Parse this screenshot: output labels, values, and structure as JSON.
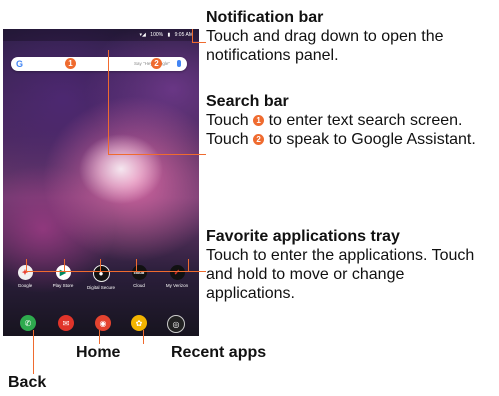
{
  "status_bar": {
    "signal": "▾◢",
    "battery": "100%",
    "time": "9:05 AM"
  },
  "search_bar": {
    "logo": "G",
    "hint": "Say \"Hey Google\"",
    "marker_1": "1",
    "marker_2": "2"
  },
  "favorites": [
    {
      "label": "Google",
      "glyph": "✦",
      "color": "#f1f1f1"
    },
    {
      "label": "Play Store",
      "glyph": "▶",
      "color": "#ffffff"
    },
    {
      "label": "Digital Secure",
      "glyph": "●",
      "color": "#111111"
    },
    {
      "label": "Cloud",
      "glyph": "cloud",
      "color": "#111111"
    },
    {
      "label": "My Verizon",
      "glyph": "✓",
      "color": "#111111"
    }
  ],
  "tray": [
    {
      "name": "phone",
      "glyph": "✆",
      "color": "#2eaa4e"
    },
    {
      "name": "messages",
      "glyph": "✉",
      "color": "#e0342a"
    },
    {
      "name": "chrome",
      "glyph": "◉",
      "color": "#e4432f"
    },
    {
      "name": "photos",
      "glyph": "✿",
      "color": "#f3b400"
    },
    {
      "name": "camera",
      "glyph": "◎",
      "color": "#222222"
    }
  ],
  "callouts": {
    "notification": {
      "title": "Notification bar",
      "desc": "Touch and drag down to open the notifications panel."
    },
    "search": {
      "title": "Search bar",
      "line1_before": "Touch ",
      "marker_1": "1",
      "line1_after": " to enter text search screen.",
      "line2_before": "Touch ",
      "marker_2": "2",
      "line2_after": " to speak to Google Assistant."
    },
    "favorites": {
      "title": "Favorite applications tray",
      "desc": "Touch to enter the applications. Touch and hold to move or change applications."
    }
  },
  "nav_labels": {
    "home": "Home",
    "recent": "Recent apps",
    "back": "Back"
  },
  "colors": {
    "accent": "#ef6b2f"
  }
}
